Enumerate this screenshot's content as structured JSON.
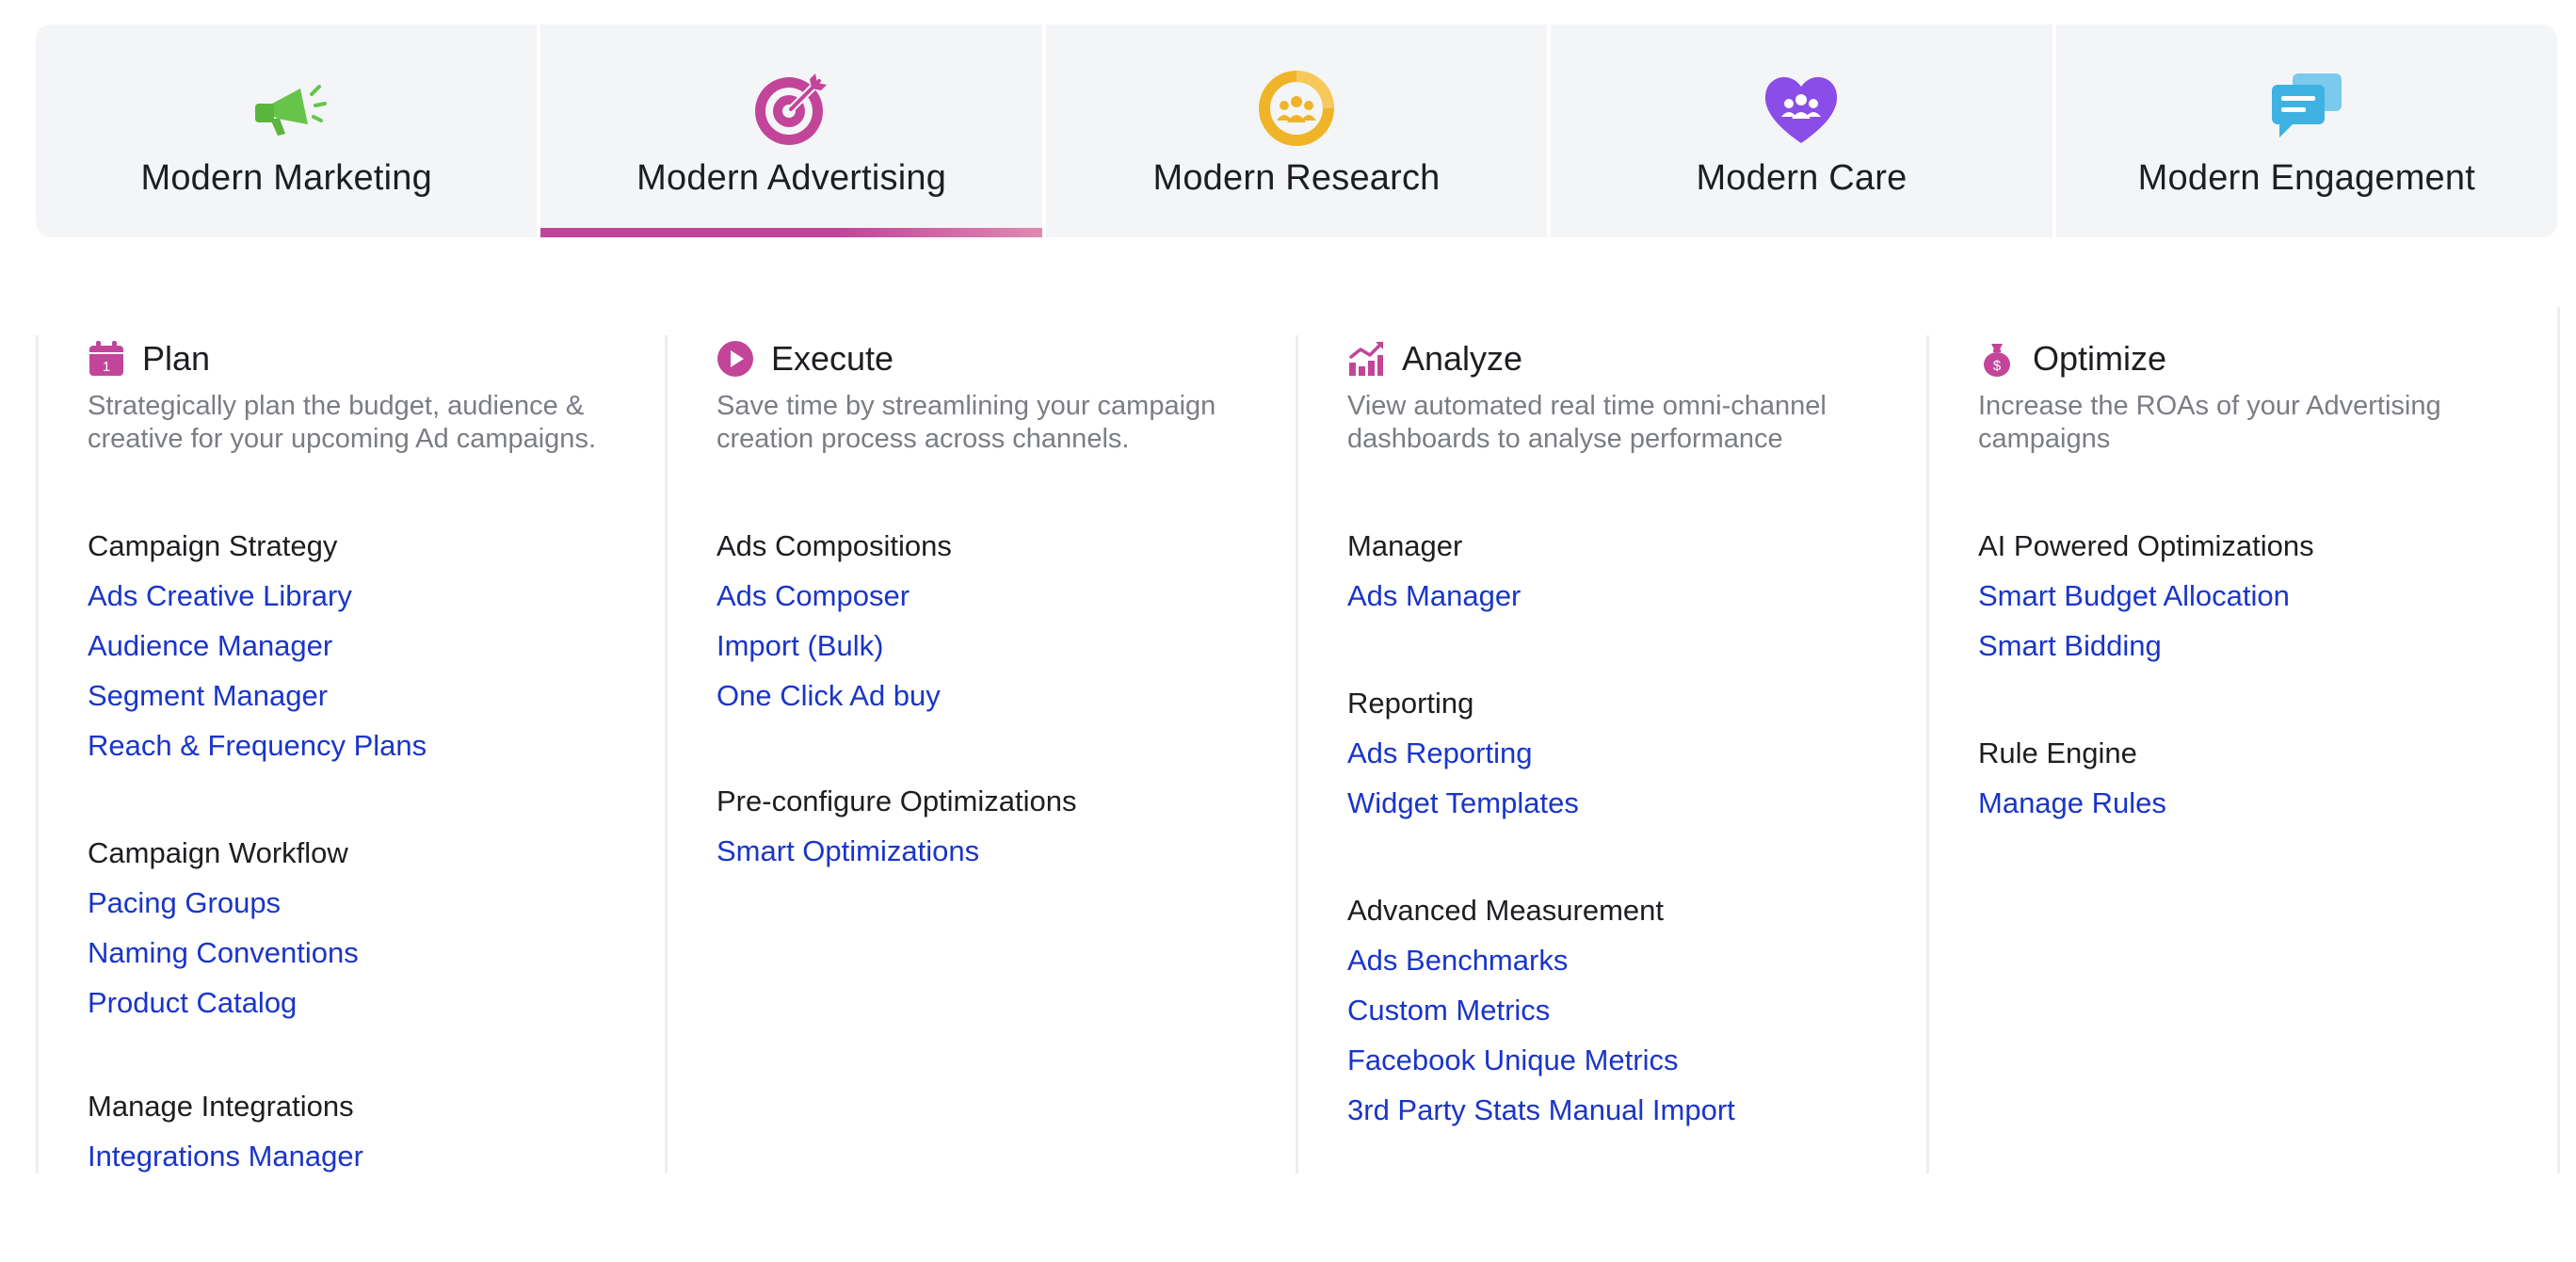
{
  "tabs": [
    {
      "label": "Modern Marketing",
      "icon": "megaphone-icon",
      "color": "#67c44a",
      "active": false
    },
    {
      "label": "Modern Advertising",
      "icon": "target-icon",
      "color": "#c2459a",
      "active": true
    },
    {
      "label": "Modern Research",
      "icon": "people-circle-icon",
      "color": "#f0b429",
      "active": false
    },
    {
      "label": "Modern Care",
      "icon": "heart-people-icon",
      "color": "#8a4de8",
      "active": false
    },
    {
      "label": "Modern Engagement",
      "icon": "chat-bubbles-icon",
      "color": "#3fb1e3",
      "active": false
    }
  ],
  "accent_color": "#c2459a",
  "link_color": "#1a35c9",
  "columns": [
    {
      "title": "Plan",
      "icon": "calendar-icon",
      "description": "Strategically plan the budget, audience & creative for your upcoming Ad campaigns.",
      "groups": [
        {
          "title": "Campaign Strategy",
          "links": [
            "Ads Creative Library",
            "Audience Manager",
            "Segment Manager",
            "Reach & Frequency Plans"
          ]
        },
        {
          "title": "Campaign Workflow",
          "links": [
            "Pacing Groups",
            "Naming Conventions",
            "Product Catalog"
          ]
        },
        {
          "title": "Manage Integrations",
          "links": [
            "Integrations Manager"
          ]
        }
      ]
    },
    {
      "title": "Execute",
      "icon": "play-icon",
      "description": "Save time by streamlining your campaign creation process across channels.",
      "groups": [
        {
          "title": "Ads Compositions",
          "links": [
            "Ads Composer",
            "Import (Bulk)",
            "One Click Ad buy"
          ]
        },
        {
          "title": "Pre-configure Optimizations",
          "links": [
            "Smart Optimizations"
          ]
        }
      ]
    },
    {
      "title": "Analyze",
      "icon": "chart-icon",
      "description": "View automated real time omni-channel dashboards to analyse performance",
      "groups": [
        {
          "title": "Manager",
          "links": [
            "Ads Manager"
          ]
        },
        {
          "title": "Reporting",
          "links": [
            "Ads Reporting",
            "Widget Templates"
          ]
        },
        {
          "title": "Advanced Measurement",
          "links": [
            "Ads Benchmarks",
            "Custom Metrics",
            "Facebook Unique Metrics",
            "3rd Party Stats Manual Import"
          ]
        }
      ]
    },
    {
      "title": "Optimize",
      "icon": "money-bag-icon",
      "description": "Increase the ROAs of your Advertising campaigns",
      "groups": [
        {
          "title": "AI Powered Optimizations",
          "links": [
            "Smart Budget Allocation",
            "Smart Bidding"
          ]
        },
        {
          "title": "Rule Engine",
          "links": [
            "Manage Rules"
          ]
        }
      ]
    }
  ]
}
